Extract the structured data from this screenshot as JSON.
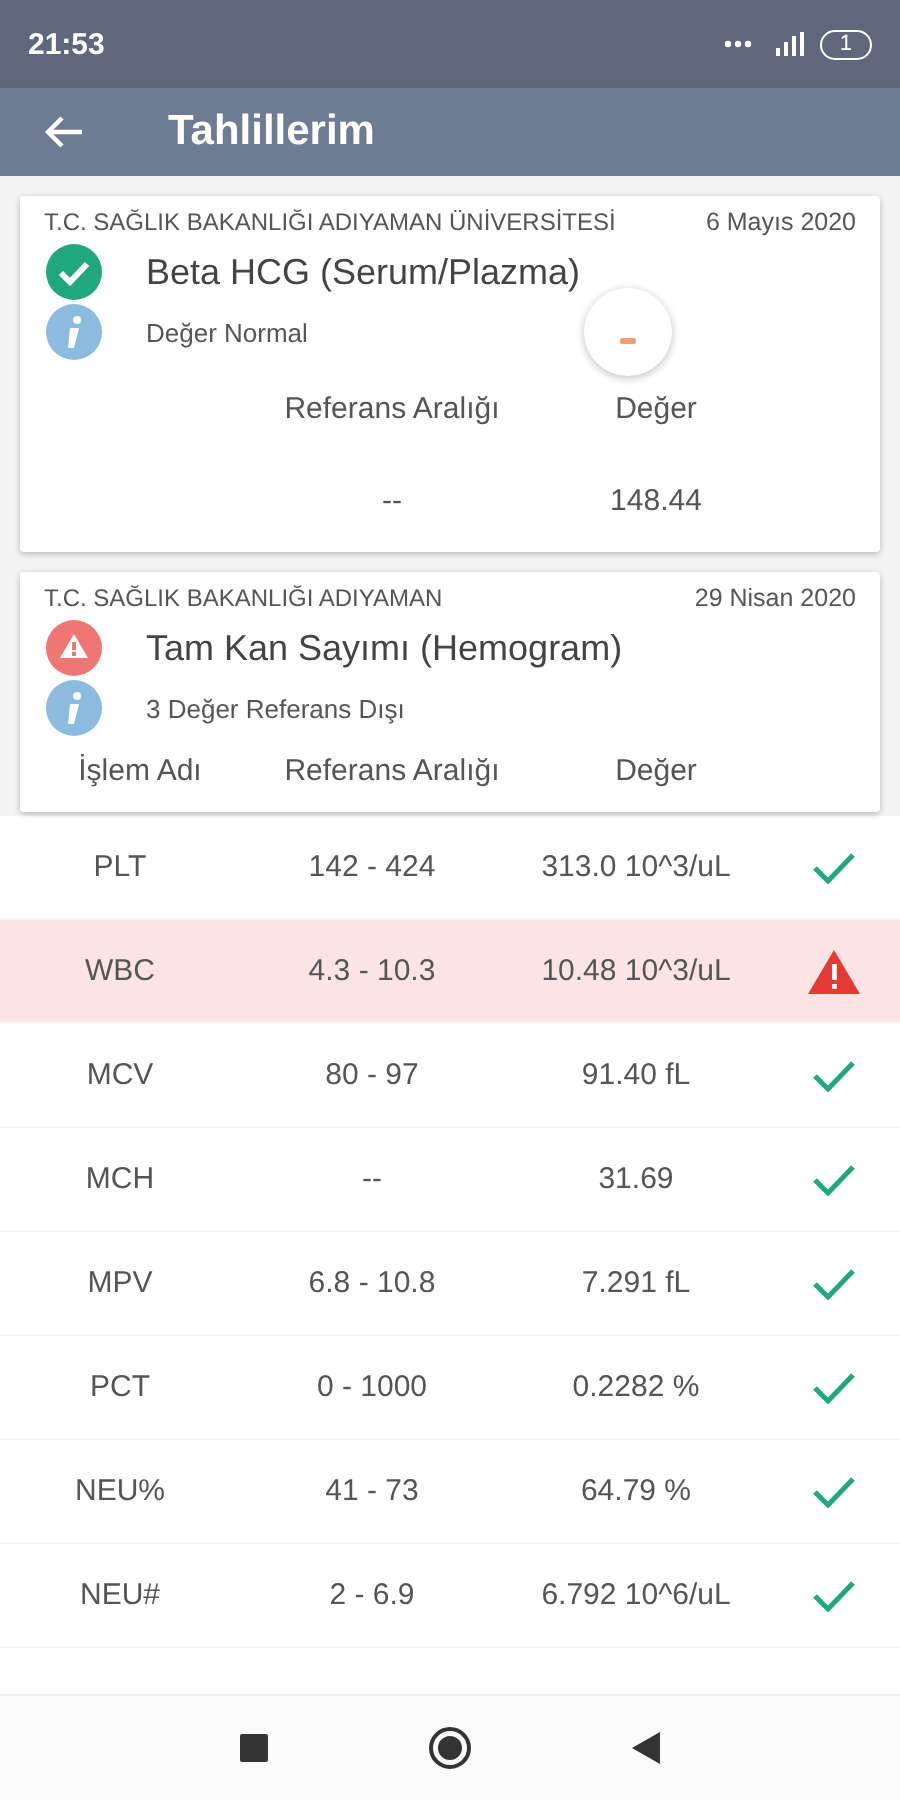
{
  "status_bar": {
    "time": "21:53",
    "battery": "1"
  },
  "app_bar": {
    "title": "Tahlillerim"
  },
  "reports": [
    {
      "institution": "T.C. SAĞLIK BAKANLIĞI ADIYAMAN ÜNİVERSİTESİ",
      "date": "6 Mayıs 2020",
      "title": "Beta HCG (Serum/Plazma)",
      "abnormal": false,
      "summary": "Değer Normal",
      "loading": true,
      "columns": [
        "",
        "Referans Aralığı",
        "Değer"
      ],
      "rows": [
        {
          "cells": [
            "",
            "--",
            "148.44"
          ]
        }
      ]
    },
    {
      "institution": "T.C. SAĞLIK BAKANLIĞI ADIYAMAN",
      "date": "29 Nisan 2020",
      "title": "Tam Kan Sayımı (Hemogram)",
      "abnormal": true,
      "summary": "3 Değer Referans Dışı",
      "loading": false,
      "columns": [
        "İşlem Adı",
        "Referans Aralığı",
        "Değer"
      ]
    }
  ],
  "results": [
    {
      "name": "PLT",
      "range": "142 - 424",
      "value": "313.0 10^3/uL",
      "flagged": false
    },
    {
      "name": "WBC",
      "range": "4.3 - 10.3",
      "value": "10.48 10^3/uL",
      "flagged": true
    },
    {
      "name": "MCV",
      "range": "80 - 97",
      "value": "91.40 fL",
      "flagged": false
    },
    {
      "name": "MCH",
      "range": "--",
      "value": "31.69",
      "flagged": false
    },
    {
      "name": "MPV",
      "range": "6.8 - 10.8",
      "value": "7.291 fL",
      "flagged": false
    },
    {
      "name": "PCT",
      "range": "0 - 1000",
      "value": "0.2282 %",
      "flagged": false
    },
    {
      "name": "NEU%",
      "range": "41 - 73",
      "value": "64.79 %",
      "flagged": false
    },
    {
      "name": "NEU#",
      "range": "2 - 6.9",
      "value": "6.792 10^6/uL",
      "flagged": false
    }
  ]
}
